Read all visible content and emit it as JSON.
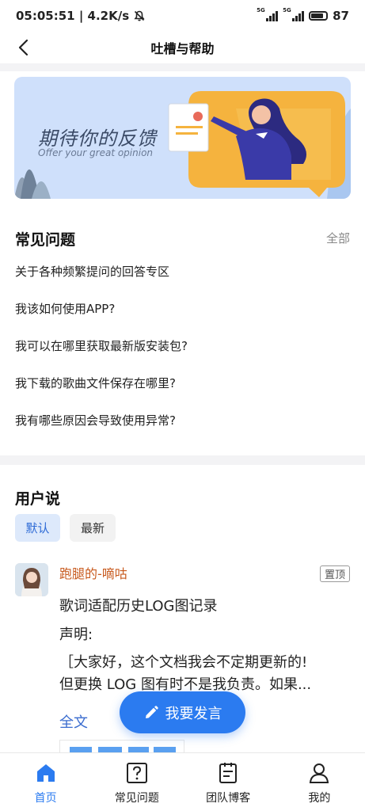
{
  "status_bar": {
    "time_speed": "05:05:51 | 4.2K/s",
    "sim1_label": "5G",
    "sim2_label": "5G",
    "battery": "87"
  },
  "header": {
    "title": "吐槽与帮助"
  },
  "banner": {
    "title": "期待你的反馈",
    "subtitle": "Offer your great opinion"
  },
  "faq": {
    "title": "常见问题",
    "all_label": "全部",
    "items": [
      "关于各种频繁提问的回答专区",
      "我该如何使用APP?",
      "我可以在哪里获取最新版安装包?",
      "我下载的歌曲文件保存在哪里?",
      "我有哪些原因会导致使用异常?"
    ]
  },
  "users": {
    "title": "用户说",
    "tabs": [
      "默认",
      "最新"
    ],
    "post": {
      "username": "跑腿的-嘀咕",
      "pin_label": "置顶",
      "lines": [
        "歌词适配历史LOG图记录",
        "声明:",
        "［大家好，这个文档我会不定期更新的!",
        "但更换 LOG 图有时不是我负责。如果..."
      ],
      "full_text_label": "全文"
    }
  },
  "fab": {
    "label": "我要发言"
  },
  "bottom_nav": {
    "items": [
      "首页",
      "常见问题",
      "团队博客",
      "我的"
    ]
  },
  "colors": {
    "accent": "#2b7bf0",
    "username": "#c85a1e",
    "link": "#3a6ccf"
  }
}
